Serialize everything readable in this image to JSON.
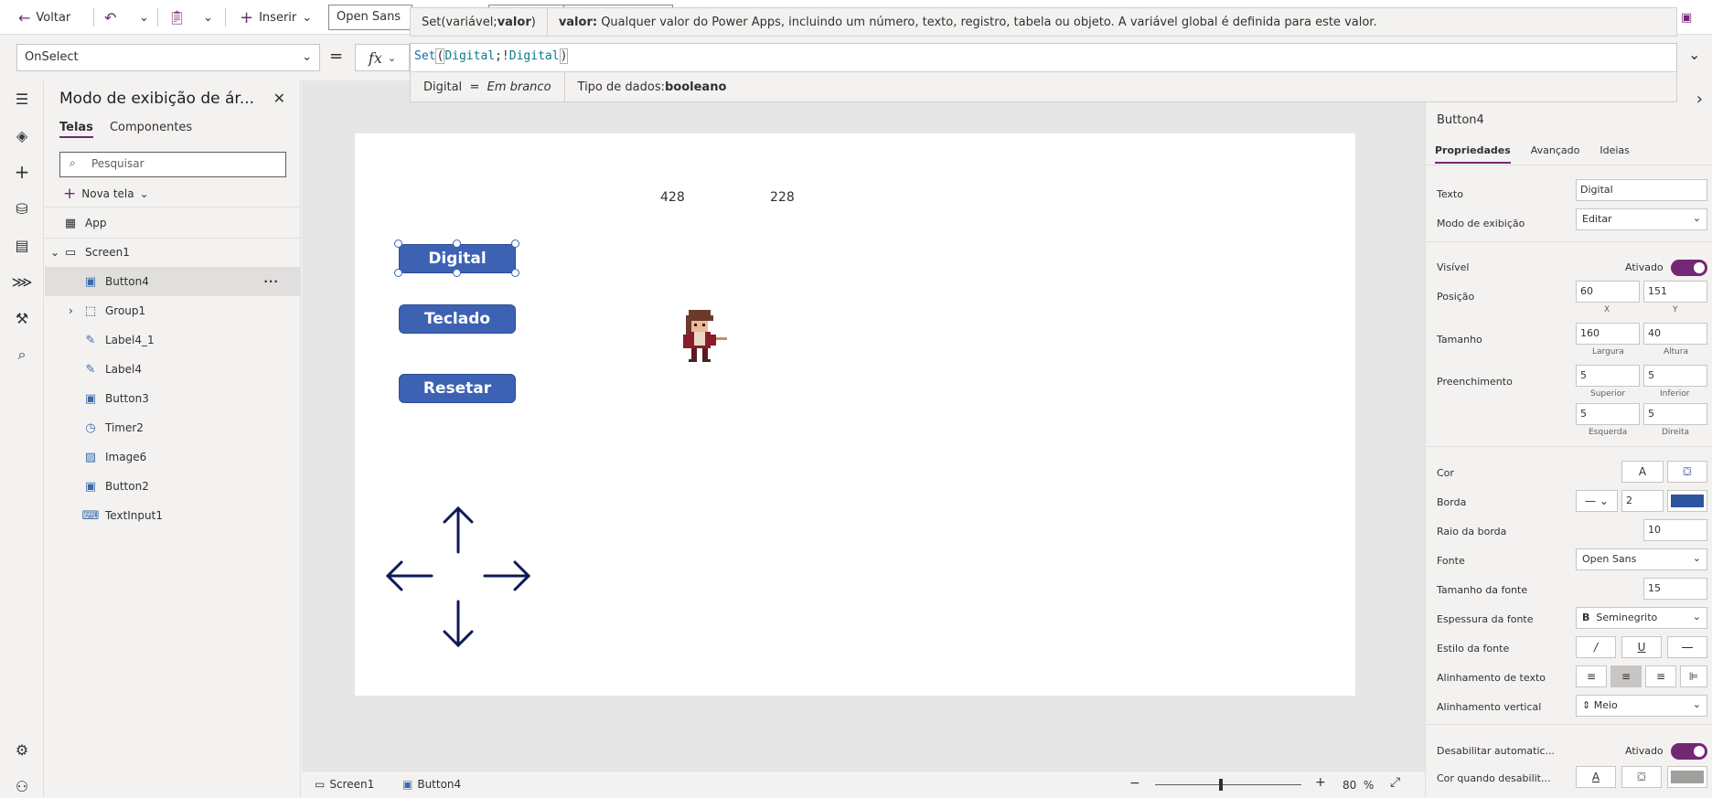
{
  "command_bar": {
    "back_label": "Voltar",
    "insert_label": "Inserir",
    "font_value": "Open Sans"
  },
  "formula_bar": {
    "property": "OnSelect",
    "equals": "=",
    "fx": "fx",
    "formula_fn": "Set",
    "formula_open": "(",
    "formula_arg1": "Digital",
    "formula_sep": ";!",
    "formula_arg2": "Digital",
    "formula_close": ")"
  },
  "tooltip": {
    "signature_prefix": "Set(variável; ",
    "signature_bold": "valor",
    "signature_suffix": ")",
    "desc_bold": "valor:",
    "desc_text": " Qualquer valor do Power Apps, incluindo um número, texto, registro, tabela ou objeto. A variável global é definida para este valor."
  },
  "hint": {
    "var_name": "Digital",
    "var_eq": "=",
    "var_value": "Em branco",
    "type_label": "Tipo de dados: ",
    "type_value": "booleano"
  },
  "tree": {
    "title": "Modo de exibição de ár...",
    "tab_screens": "Telas",
    "tab_components": "Componentes",
    "search_placeholder": "Pesquisar",
    "new_screen": "Nova tela",
    "nodes": [
      {
        "label": "App"
      },
      {
        "label": "Screen1"
      },
      {
        "label": "Button4"
      },
      {
        "label": "Group1"
      },
      {
        "label": "Label4_1"
      },
      {
        "label": "Label4"
      },
      {
        "label": "Button3"
      },
      {
        "label": "Timer2"
      },
      {
        "label": "Image6"
      },
      {
        "label": "Button2"
      },
      {
        "label": "TextInput1"
      }
    ]
  },
  "canvas": {
    "num1": "428",
    "num2": "228",
    "btn_digital": "Digital",
    "btn_teclado": "Teclado",
    "btn_resetar": "Resetar"
  },
  "status": {
    "screen": "Screen1",
    "control": "Button4",
    "zoom_value": "80",
    "zoom_unit": "%",
    "zoom_fraction": 0.45
  },
  "props": {
    "control_name": "Button4",
    "tabs": [
      "Propriedades",
      "Avançado",
      "Ideias"
    ],
    "texto_label": "Texto",
    "texto_value": "Digital",
    "modo_label": "Modo de exibição",
    "modo_value": "Editar",
    "visivel_label": "Visível",
    "visivel_state": "Ativado",
    "posicao_label": "Posição",
    "pos_x": "60",
    "pos_y": "151",
    "x_label": "X",
    "y_label": "Y",
    "tamanho_label": "Tamanho",
    "width": "160",
    "height": "40",
    "largura_label": "Largura",
    "altura_label": "Altura",
    "preench_label": "Preenchimento",
    "pad_top": "5",
    "pad_bottom": "5",
    "pad_left": "5",
    "pad_right": "5",
    "superior_label": "Superior",
    "inferior_label": "Inferior",
    "esquerda_label": "Esquerda",
    "direita_label": "Direita",
    "cor_label": "Cor",
    "cor_text_glyph": "A",
    "borda_label": "Borda",
    "borda_value": "2",
    "border_color": "#2d55a0",
    "raio_label": "Raio da borda",
    "raio_value": "10",
    "fonte_label": "Fonte",
    "fonte_value": "Open Sans",
    "tam_fonte_label": "Tamanho da fonte",
    "tam_fonte_value": "15",
    "espessura_label": "Espessura da fonte",
    "espessura_glyph": "B",
    "espessura_value": "Seminegrito",
    "estilo_label": "Estilo da fonte",
    "italic_glyph": "/",
    "underline_glyph": "U",
    "strike_glyph": "—",
    "alinh_texto_label": "Alinhamento de texto",
    "alinh_vert_label": "Alinhamento vertical",
    "alinh_vert_value": "Meio",
    "desab_label": "Desabilitar automatic...",
    "desab_state": "Ativado",
    "cor_desab_label": "Cor quando desabilit...",
    "cor_desab_glyph": "A"
  },
  "colors": {
    "accent": "#742774",
    "button_fill": "#3d62b4",
    "arrow_color": "#0d1a57"
  }
}
